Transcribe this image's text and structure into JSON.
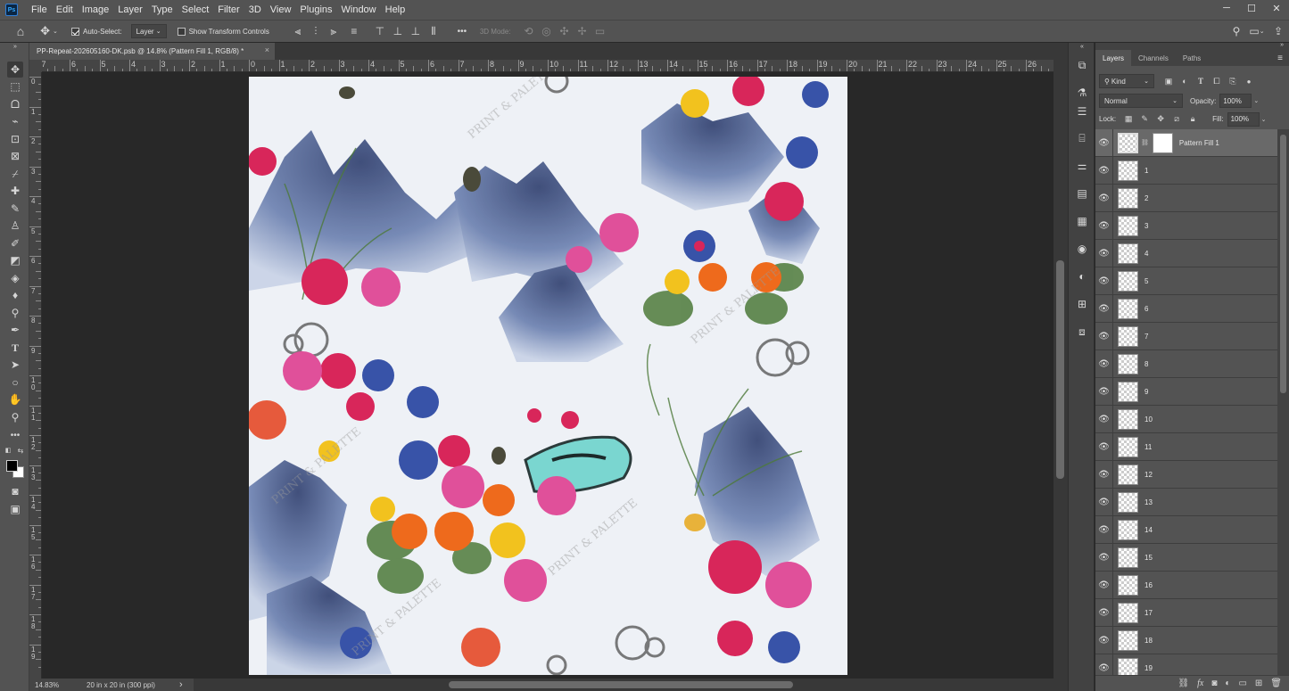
{
  "app": {
    "logo": "Ps"
  },
  "menu": [
    "File",
    "Edit",
    "Image",
    "Layer",
    "Type",
    "Select",
    "Filter",
    "3D",
    "View",
    "Plugins",
    "Window",
    "Help"
  ],
  "window_controls": {
    "minimize": "─",
    "maximize": "☐",
    "close": "✕"
  },
  "options_bar": {
    "auto_select_label": "Auto-Select:",
    "auto_select_checked": true,
    "auto_select_target": "Layer",
    "show_transform_label": "Show Transform Controls",
    "show_transform_checked": false,
    "more": "•••",
    "mode_3d_label": "3D Mode:"
  },
  "document": {
    "tab_title": "PP-Repeat-202605160-DK.psb @ 14.8% (Pattern Fill 1, RGB/8) *",
    "close": "×"
  },
  "ruler_top_labels": [
    "7",
    "6",
    "5",
    "4",
    "3",
    "2",
    "1",
    "0",
    "1",
    "2",
    "3",
    "4",
    "5",
    "6",
    "7",
    "8",
    "9",
    "10",
    "11",
    "12",
    "13",
    "14",
    "15",
    "16",
    "17",
    "18",
    "19",
    "20",
    "21",
    "22",
    "23",
    "24",
    "25",
    "26"
  ],
  "ruler_left_labels": [
    "0",
    "1",
    "2",
    "3",
    "4",
    "5",
    "6",
    "7",
    "8",
    "9",
    "1 0",
    "1 1",
    "1 2",
    "1 3",
    "1 4",
    "1 5",
    "1 6",
    "1 7",
    "1 8",
    "1 9"
  ],
  "status": {
    "zoom": "14.83%",
    "doc_size": "20 in x 20 in (300 ppi)",
    "arrow": "›"
  },
  "artwork": {
    "watermark": "PRINT & PALETTE",
    "colors": {
      "background": "#eef1f6",
      "mountain": "#4a5f8f",
      "peony": "#d8265a",
      "pink": "#e0509a",
      "blue_flower": "#3853a8",
      "orange": "#ee6a1c",
      "yellow": "#f2c21e",
      "leaf": "#4d7a3a",
      "rock": "#7ad6d0"
    }
  },
  "layers_panel": {
    "tabs": [
      "Layers",
      "Channels",
      "Paths"
    ],
    "active_tab": "Layers",
    "filter_kind": "Kind",
    "blend_mode": "Normal",
    "opacity_label": "Opacity:",
    "opacity_value": "100%",
    "lock_label": "Lock:",
    "fill_label": "Fill:",
    "fill_value": "100%",
    "selected_layer": "Pattern Fill 1",
    "layers": [
      "1",
      "2",
      "3",
      "4",
      "5",
      "6",
      "7",
      "8",
      "9",
      "10",
      "11",
      "12",
      "13",
      "14",
      "15",
      "16",
      "17",
      "18",
      "19"
    ]
  }
}
